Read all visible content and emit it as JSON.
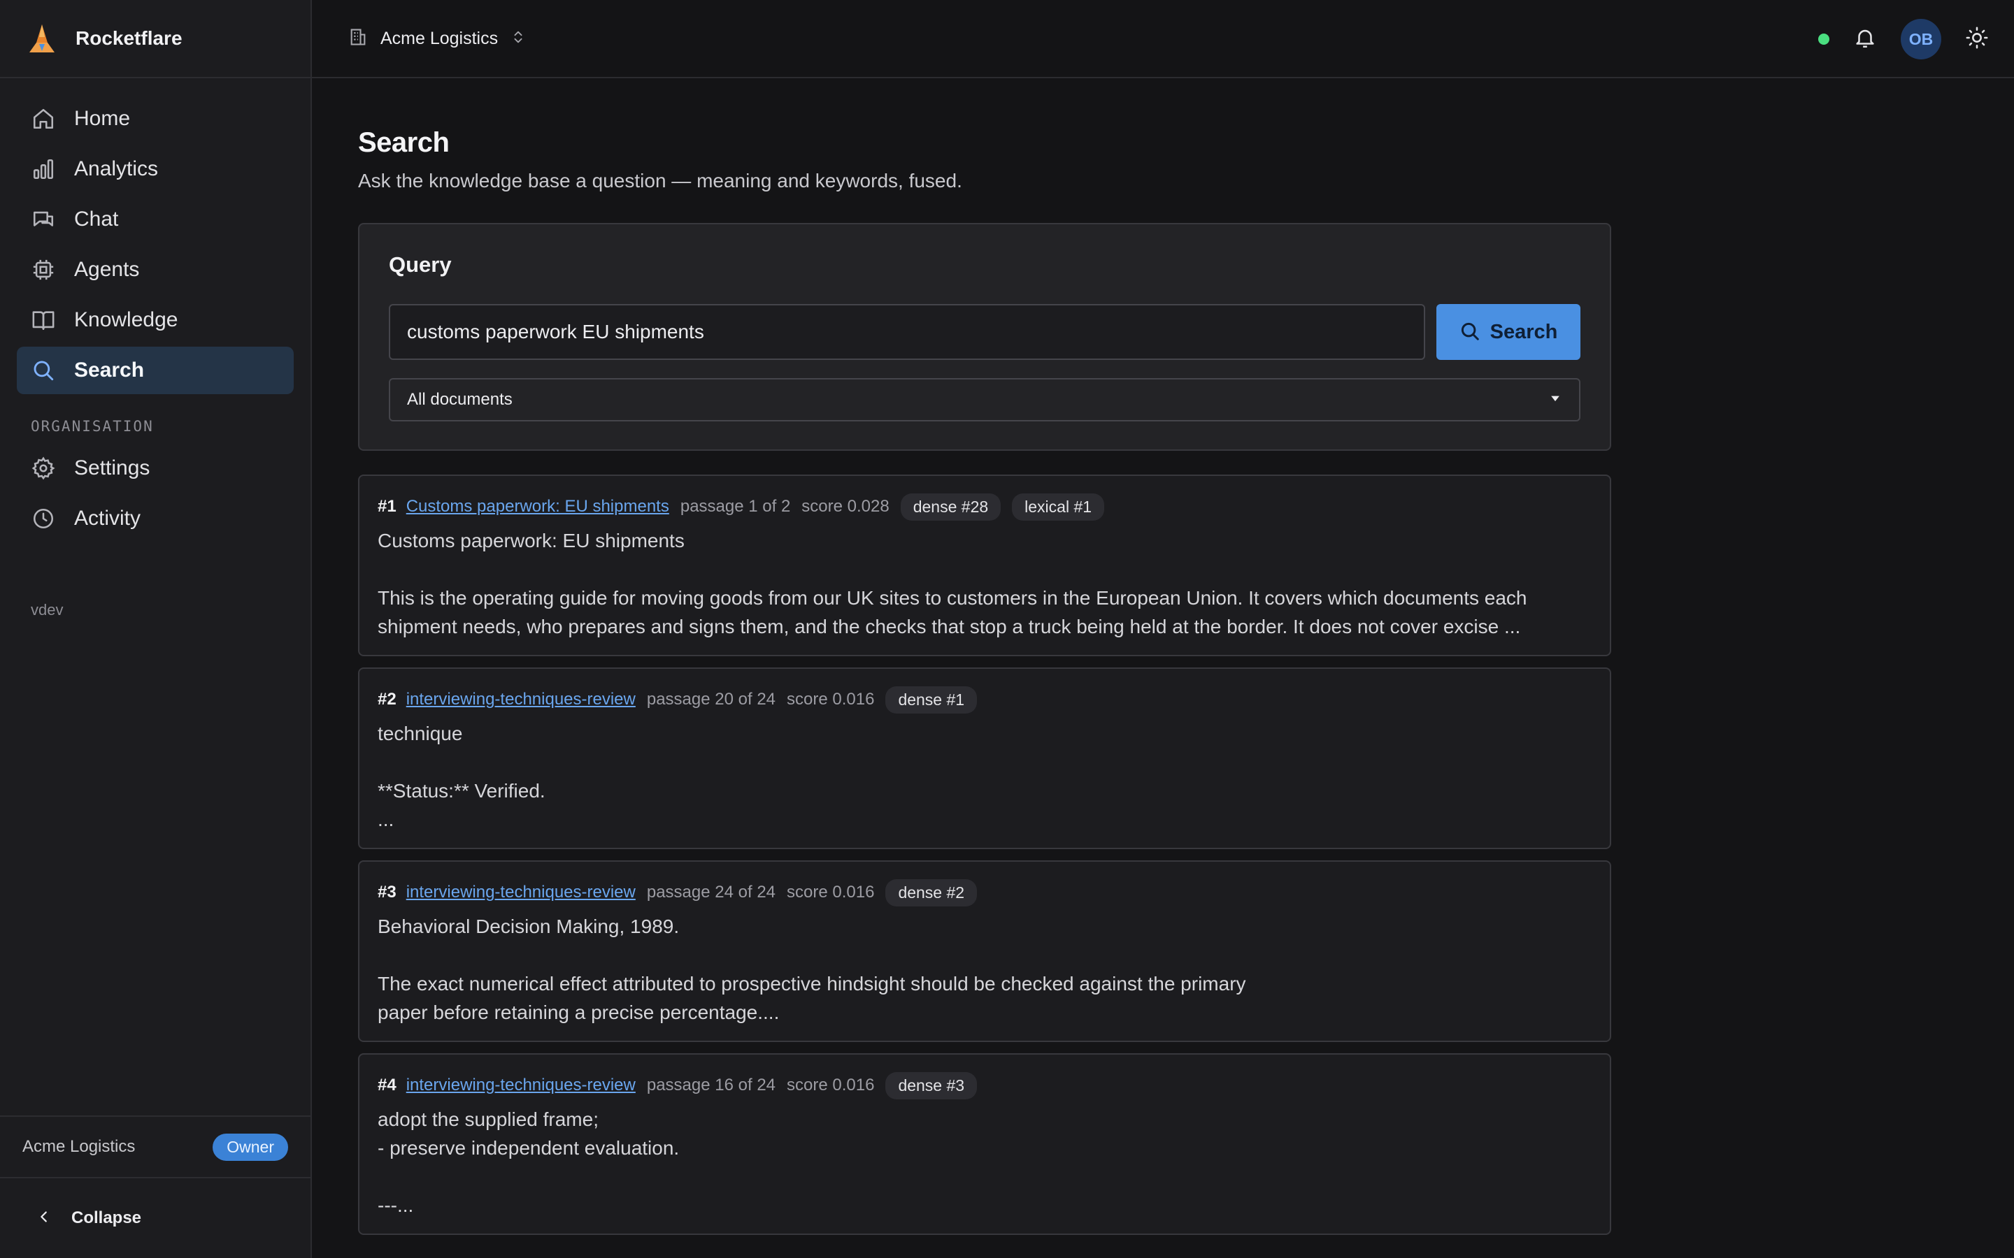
{
  "app": {
    "name": "Rocketflare"
  },
  "sidebar": {
    "items": [
      {
        "label": "Home",
        "icon": "home-icon"
      },
      {
        "label": "Analytics",
        "icon": "bar-chart-icon"
      },
      {
        "label": "Chat",
        "icon": "chat-icon"
      },
      {
        "label": "Agents",
        "icon": "cpu-icon"
      },
      {
        "label": "Knowledge",
        "icon": "book-icon"
      },
      {
        "label": "Search",
        "icon": "search-icon",
        "active": true
      }
    ],
    "section_label": "ORGANISATION",
    "org_items": [
      {
        "label": "Settings",
        "icon": "gear-icon"
      },
      {
        "label": "Activity",
        "icon": "clock-icon"
      }
    ],
    "version": "vdev",
    "org_name": "Acme Logistics",
    "role_badge": "Owner",
    "collapse_label": "Collapse"
  },
  "topbar": {
    "workspace": "Acme Logistics",
    "avatar_initials": "OB",
    "status_color": "#4ade80"
  },
  "page": {
    "title": "Search",
    "subtitle": "Ask the knowledge base a question — meaning and keywords, fused."
  },
  "query": {
    "title": "Query",
    "input_value": "customs paperwork EU shipments",
    "button_label": "Search",
    "scope": "All documents"
  },
  "results": [
    {
      "rank": "#1",
      "doc": "Customs paperwork: EU shipments",
      "passage": "passage 1 of 2",
      "score": "score 0.028",
      "tags": [
        "dense #28",
        "lexical #1"
      ],
      "body": "Customs paperwork: EU shipments\n\nThis is the operating guide for moving goods from our UK sites to customers in the European Union. It covers which documents each shipment needs, who prepares and signs them, and the checks that stop a truck being held at the border. It does not cover excise ..."
    },
    {
      "rank": "#2",
      "doc": "interviewing-techniques-review",
      "passage": "passage 20 of 24",
      "score": "score 0.016",
      "tags": [
        "dense #1"
      ],
      "body": "technique\n\n**Status:** Verified.\n..."
    },
    {
      "rank": "#3",
      "doc": "interviewing-techniques-review",
      "passage": "passage 24 of 24",
      "score": "score 0.016",
      "tags": [
        "dense #2"
      ],
      "body": "Behavioral Decision Making, 1989.\n\nThe exact numerical effect attributed to prospective hindsight should be checked against the primary\npaper before retaining a precise percentage...."
    },
    {
      "rank": "#4",
      "doc": "interviewing-techniques-review",
      "passage": "passage 16 of 24",
      "score": "score 0.016",
      "tags": [
        "dense #3"
      ],
      "body": "adopt the supplied frame;\n- preserve independent evaluation.\n\n---..."
    }
  ]
}
